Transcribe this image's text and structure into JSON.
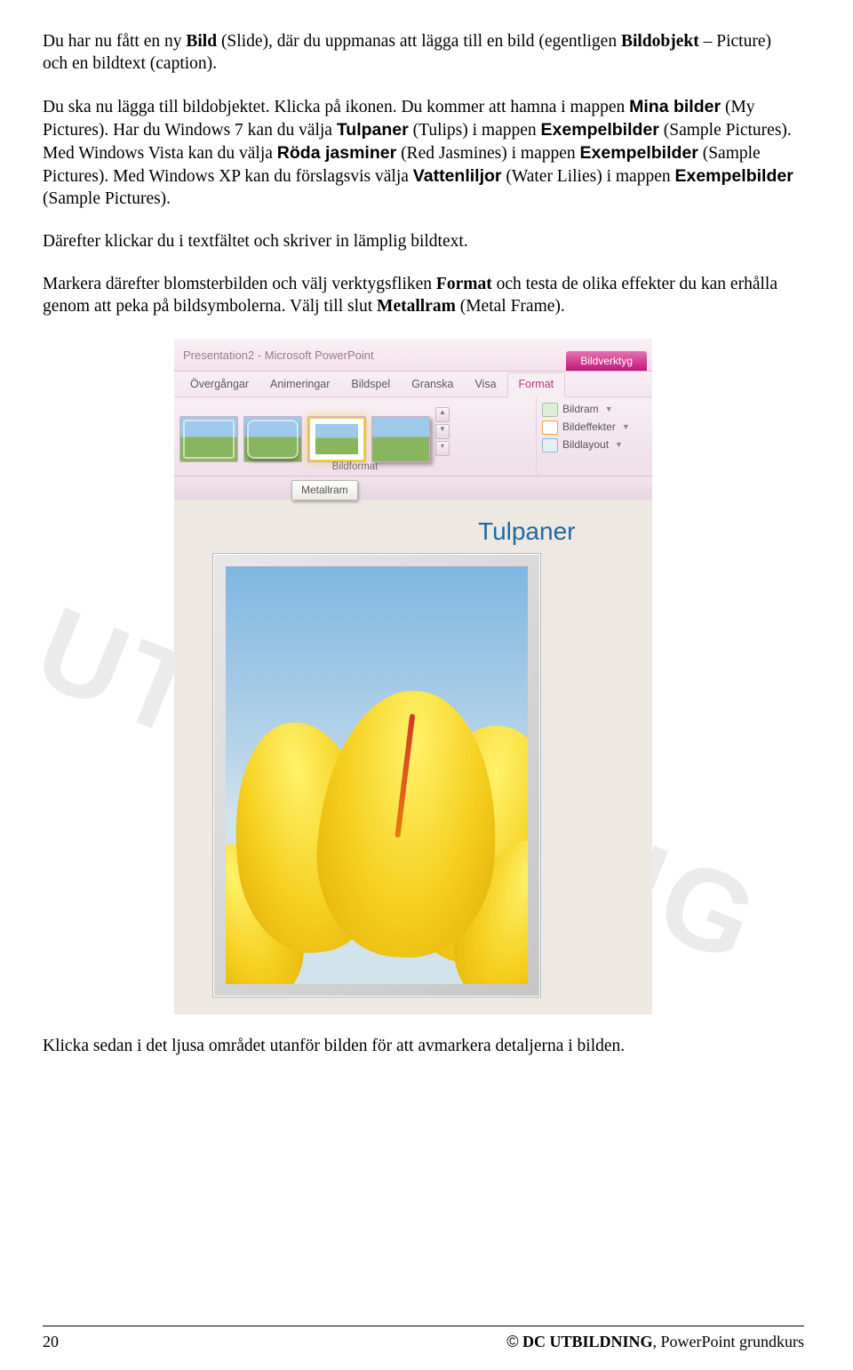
{
  "paragraphs": {
    "p1a": "Du har nu fått en ny ",
    "p1b": "Bild",
    "p1c": " (Slide), där du uppmanas att lägga till en bild (egentligen ",
    "p1d": "Bildobjekt",
    "p1e": " – Picture) och en bildtext (caption).",
    "p2a": "Du ska nu lägga till bildobjektet. Klicka på ikonen. Du kommer att hamna i mappen ",
    "p2b": "Mina bilder",
    "p2c": " (My Pictures). Har du Windows 7 kan du välja ",
    "p2d": "Tulpaner",
    "p2e": " (Tulips) i mappen ",
    "p2f": "Exempelbilder",
    "p2g": " (Sample Pictures). Med Windows Vista kan du välja ",
    "p2h": "Röda jasminer",
    "p2i": " (Red Jasmines) i mappen ",
    "p2j": "Exempelbilder",
    "p2k": " (Sample Pictures). Med Windows XP kan du förslagsvis välja ",
    "p2l": "Vattenliljor",
    "p2m": " (Water Lilies) i mappen ",
    "p2n": "Exempelbilder",
    "p2o": " (Sample Pictures).",
    "p3": "Därefter klickar du i textfältet och skriver in lämplig bildtext.",
    "p4a": "Markera därefter blomsterbilden och välj verktygsfliken ",
    "p4b": "Format",
    "p4c": " och testa de olika effekter du kan erhålla genom att peka på bildsymbolerna. Välj till slut ",
    "p4d": "Metallram",
    "p4e": " (Metal Frame).",
    "p5": "Klicka sedan i det ljusa området utanför bilden för att avmarkera detaljerna i bilden."
  },
  "watermark": "DC UTBILDNING",
  "ribbon": {
    "title": "Presentation2 - Microsoft PowerPoint",
    "tool_group": "Bildverktyg",
    "tabs": [
      "Övergångar",
      "Animeringar",
      "Bildspel",
      "Granska",
      "Visa",
      "Format"
    ],
    "gallery_label": "Bildformat",
    "side": {
      "a": "Bildram",
      "b": "Bildeffekter",
      "c": "Bildlayout"
    },
    "tooltip": "Metallram"
  },
  "slide": {
    "caption": "Tulpaner"
  },
  "footer": {
    "page": "20",
    "copyright_symbol": "©",
    "copyright_name": " DC UTBILDNING",
    "copyright_tail": ", PowerPoint grundkurs"
  }
}
